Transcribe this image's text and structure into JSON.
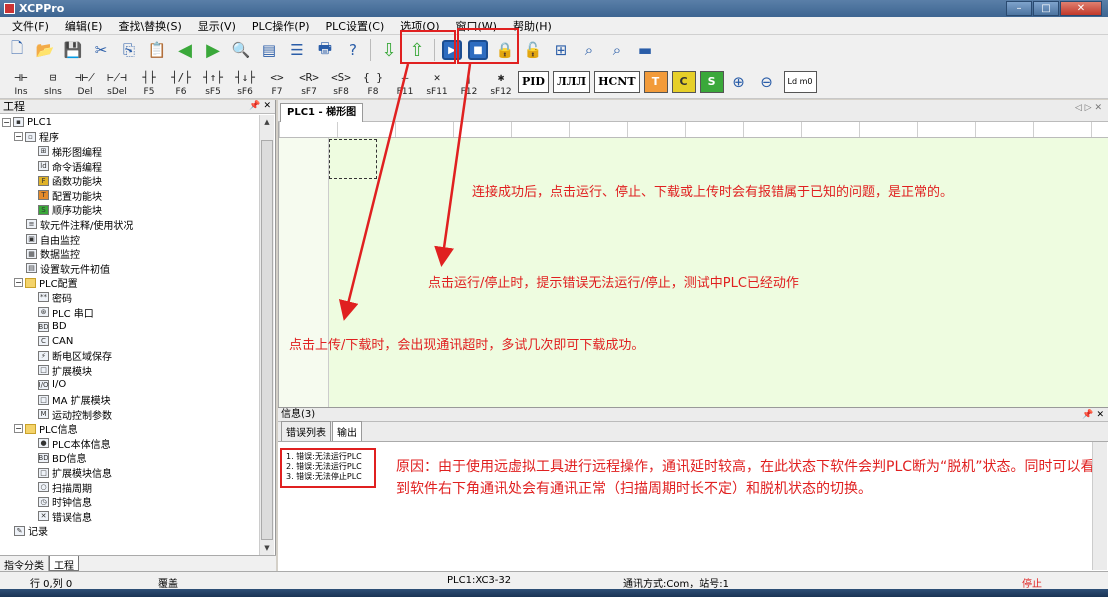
{
  "window": {
    "title": "XCPPro",
    "min": "–",
    "max": "□",
    "close": "✕"
  },
  "menu": [
    "文件(F)",
    "编辑(E)",
    "查找\\替换(S)",
    "显示(V)",
    "PLC操作(P)",
    "PLC设置(C)",
    "选项(O)",
    "窗口(W)",
    "帮助(H)"
  ],
  "toolbar1": {
    "new": "🗋",
    "open": "📂",
    "save": "💾",
    "cut": "✂",
    "copy": "⎘",
    "paste": "📋",
    "back": "◀",
    "forward": "▶",
    "find": "🔍",
    "print_preview": "▤",
    "list": "☰",
    "print": "🖶",
    "help": "?",
    "download": "⇩",
    "upload": "⇧",
    "run": "▶",
    "stop": "■",
    "lock1": "🔒",
    "lock2": "🔓",
    "monitor": "⊞",
    "zoom_view": "⌕",
    "zoom_doc": "⌕",
    "dash": "▬"
  },
  "toolbar2": {
    "ladder": [
      {
        "sym": "⊣⊢",
        "lbl": "Ins"
      },
      {
        "sym": "⊟",
        "lbl": "sIns"
      },
      {
        "sym": "⊣⊬",
        "lbl": "Del"
      },
      {
        "sym": "⊬⊣",
        "lbl": "sDel"
      },
      {
        "sym": "┤├",
        "lbl": "F5"
      },
      {
        "sym": "┤/├",
        "lbl": "F6"
      },
      {
        "sym": "┤↑├",
        "lbl": "sF5"
      },
      {
        "sym": "┤↓├",
        "lbl": "sF6"
      },
      {
        "sym": "<>",
        "lbl": "F7"
      },
      {
        "sym": "<R>",
        "lbl": "sF7"
      },
      {
        "sym": "<S>",
        "lbl": "sF8"
      },
      {
        "sym": "{ }",
        "lbl": "F8"
      },
      {
        "sym": "—",
        "lbl": "F11"
      },
      {
        "sym": "✕",
        "lbl": "sF11"
      },
      {
        "sym": "|",
        "lbl": "F12"
      },
      {
        "sym": "✱",
        "lbl": "sF12"
      }
    ],
    "pid": "PID",
    "pulse": "ЛЛЛ",
    "hcnt": "HCNT",
    "t_btn": "T",
    "c_btn": "C",
    "s_btn": "S",
    "zoom_in": "⊕",
    "zoom_out": "⊖",
    "ldm0": "Ld m0"
  },
  "left_panel": {
    "title": "工程",
    "pin": "📌 ✕",
    "tree": [
      {
        "indent": 0,
        "exp": "−",
        "icon": "plc",
        "icon_txt": "▪",
        "label": "PLC1"
      },
      {
        "indent": 1,
        "exp": "−",
        "icon": "doc",
        "icon_txt": "▫",
        "label": "程序"
      },
      {
        "indent": 3,
        "exp": "",
        "icon": "doc",
        "icon_txt": "⊞",
        "label": "梯形图编程"
      },
      {
        "indent": 3,
        "exp": "",
        "icon": "doc",
        "icon_txt": "ld",
        "label": "命令语编程"
      },
      {
        "indent": 3,
        "exp": "",
        "icon": "yellow",
        "icon_txt": "F",
        "label": "函数功能块"
      },
      {
        "indent": 3,
        "exp": "",
        "icon": "orange",
        "icon_txt": "T",
        "label": "配置功能块"
      },
      {
        "indent": 3,
        "exp": "",
        "icon": "green",
        "icon_txt": "S",
        "label": "顺序功能块"
      },
      {
        "indent": 2,
        "exp": "",
        "icon": "doc",
        "icon_txt": "≡",
        "label": "软元件注释/使用状况"
      },
      {
        "indent": 2,
        "exp": "",
        "icon": "doc",
        "icon_txt": "▣",
        "label": "自由监控"
      },
      {
        "indent": 2,
        "exp": "",
        "icon": "doc",
        "icon_txt": "▦",
        "label": "数据监控"
      },
      {
        "indent": 2,
        "exp": "",
        "icon": "doc",
        "icon_txt": "▤",
        "label": "设置软元件初值"
      },
      {
        "indent": 1,
        "exp": "−",
        "icon": "folder",
        "icon_txt": "",
        "label": "PLC配置"
      },
      {
        "indent": 3,
        "exp": "",
        "icon": "doc",
        "icon_txt": "**",
        "label": "密码"
      },
      {
        "indent": 3,
        "exp": "",
        "icon": "doc",
        "icon_txt": "⊛",
        "label": "PLC 串口"
      },
      {
        "indent": 3,
        "exp": "",
        "icon": "doc",
        "icon_txt": "BD",
        "label": "BD"
      },
      {
        "indent": 3,
        "exp": "",
        "icon": "doc",
        "icon_txt": "C",
        "label": "CAN"
      },
      {
        "indent": 3,
        "exp": "",
        "icon": "doc",
        "icon_txt": "⚡",
        "label": "断电区域保存"
      },
      {
        "indent": 3,
        "exp": "",
        "icon": "doc",
        "icon_txt": "□",
        "label": "扩展模块"
      },
      {
        "indent": 3,
        "exp": "",
        "icon": "doc",
        "icon_txt": "I/O",
        "label": "I/O"
      },
      {
        "indent": 3,
        "exp": "",
        "icon": "doc",
        "icon_txt": "□",
        "label": "MA 扩展模块"
      },
      {
        "indent": 3,
        "exp": "",
        "icon": "doc",
        "icon_txt": "M",
        "label": "运动控制参数"
      },
      {
        "indent": 1,
        "exp": "−",
        "icon": "folder",
        "icon_txt": "",
        "label": "PLC信息"
      },
      {
        "indent": 3,
        "exp": "",
        "icon": "doc",
        "icon_txt": "●",
        "label": "PLC本体信息"
      },
      {
        "indent": 3,
        "exp": "",
        "icon": "doc",
        "icon_txt": "BD",
        "label": "BD信息"
      },
      {
        "indent": 3,
        "exp": "",
        "icon": "doc",
        "icon_txt": "□",
        "label": "扩展模块信息"
      },
      {
        "indent": 3,
        "exp": "",
        "icon": "doc",
        "icon_txt": "○",
        "label": "扫描周期"
      },
      {
        "indent": 3,
        "exp": "",
        "icon": "doc",
        "icon_txt": "◷",
        "label": "时钟信息"
      },
      {
        "indent": 3,
        "exp": "",
        "icon": "doc",
        "icon_txt": "✕",
        "label": "错误信息"
      },
      {
        "indent": 1,
        "exp": "",
        "icon": "doc",
        "icon_txt": "✎",
        "label": "记录"
      }
    ],
    "tabs": [
      "指令分类",
      "工程"
    ]
  },
  "editor": {
    "tab": "PLC1 - 梯形图",
    "tab_ctl": "◁ ▷ ✕",
    "notes": {
      "run_stop": "点击运行/停止时，提示错误无法运行/停止，测试中PLC已经动作",
      "connected": "连接成功后，点击运行、停止、下载或上传时会有报错属于已知的问题，是正常的。",
      "upload_download": "点击上传/下载时，会出现通讯超时，多试几次即可下载成功。"
    }
  },
  "info": {
    "title": "信息(3)",
    "pin": "📌 ✕",
    "tabs": [
      "错误列表",
      "输出"
    ],
    "errors": [
      "1. 错误:无法运行PLC",
      "2. 错误:无法运行PLC",
      "3. 错误:无法停止PLC"
    ],
    "reason": "原因：由于使用远虚拟工具进行远程操作，通讯延时较高，在此状态下软件会判PLC断为“脱机”状态。同时可以看到软件右下角通讯处会有通讯正常（扫描周期时长不定）和脱机状态的切换。"
  },
  "status": {
    "position": "行 0,列 0",
    "mode": "覆盖",
    "plc": "PLC1:XC3-32",
    "comm": "通讯方式:Com，站号:1",
    "state": "停止"
  },
  "colors": {
    "annotation": "#e02020",
    "ladder_bg": "#eefce0"
  }
}
